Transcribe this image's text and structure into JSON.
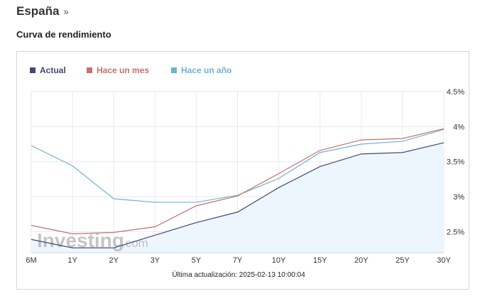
{
  "header": {
    "title": "España",
    "chevron": "»",
    "section_title": "Curva de rendimiento"
  },
  "chart_data": {
    "type": "line",
    "title": "",
    "xlabel": "",
    "ylabel": "",
    "categories": [
      "6M",
      "1Y",
      "2Y",
      "3Y",
      "5Y",
      "7Y",
      "10Y",
      "15Y",
      "20Y",
      "25Y",
      "30Y"
    ],
    "y_ticks": [
      "2.5%",
      "3%",
      "3.5%",
      "4%",
      "4.5%"
    ],
    "y_tick_values": [
      2.5,
      3.0,
      3.5,
      4.0,
      4.5
    ],
    "ylim": [
      2.2,
      4.5
    ],
    "y_axis_position": "right",
    "grid": true,
    "legend_position": "top-left",
    "series": [
      {
        "name": "Actual",
        "color": "#3e4a7a",
        "area": true,
        "values": [
          2.39,
          2.27,
          2.27,
          2.45,
          2.63,
          2.78,
          3.13,
          3.43,
          3.61,
          3.63,
          3.77
        ]
      },
      {
        "name": "Hace un mes",
        "color": "#c8706a",
        "values": [
          2.59,
          2.47,
          2.49,
          2.57,
          2.87,
          3.01,
          3.33,
          3.66,
          3.81,
          3.83,
          3.97
        ]
      },
      {
        "name": "Hace un año",
        "color": "#6fb2d6",
        "values": [
          3.73,
          3.44,
          2.97,
          2.92,
          2.92,
          3.02,
          3.26,
          3.63,
          3.75,
          3.79,
          3.96
        ]
      }
    ],
    "footer": "Última actualización: 2025-02-13 10:00:04",
    "watermark": {
      "main": "Investing",
      "suffix": ".com"
    }
  }
}
